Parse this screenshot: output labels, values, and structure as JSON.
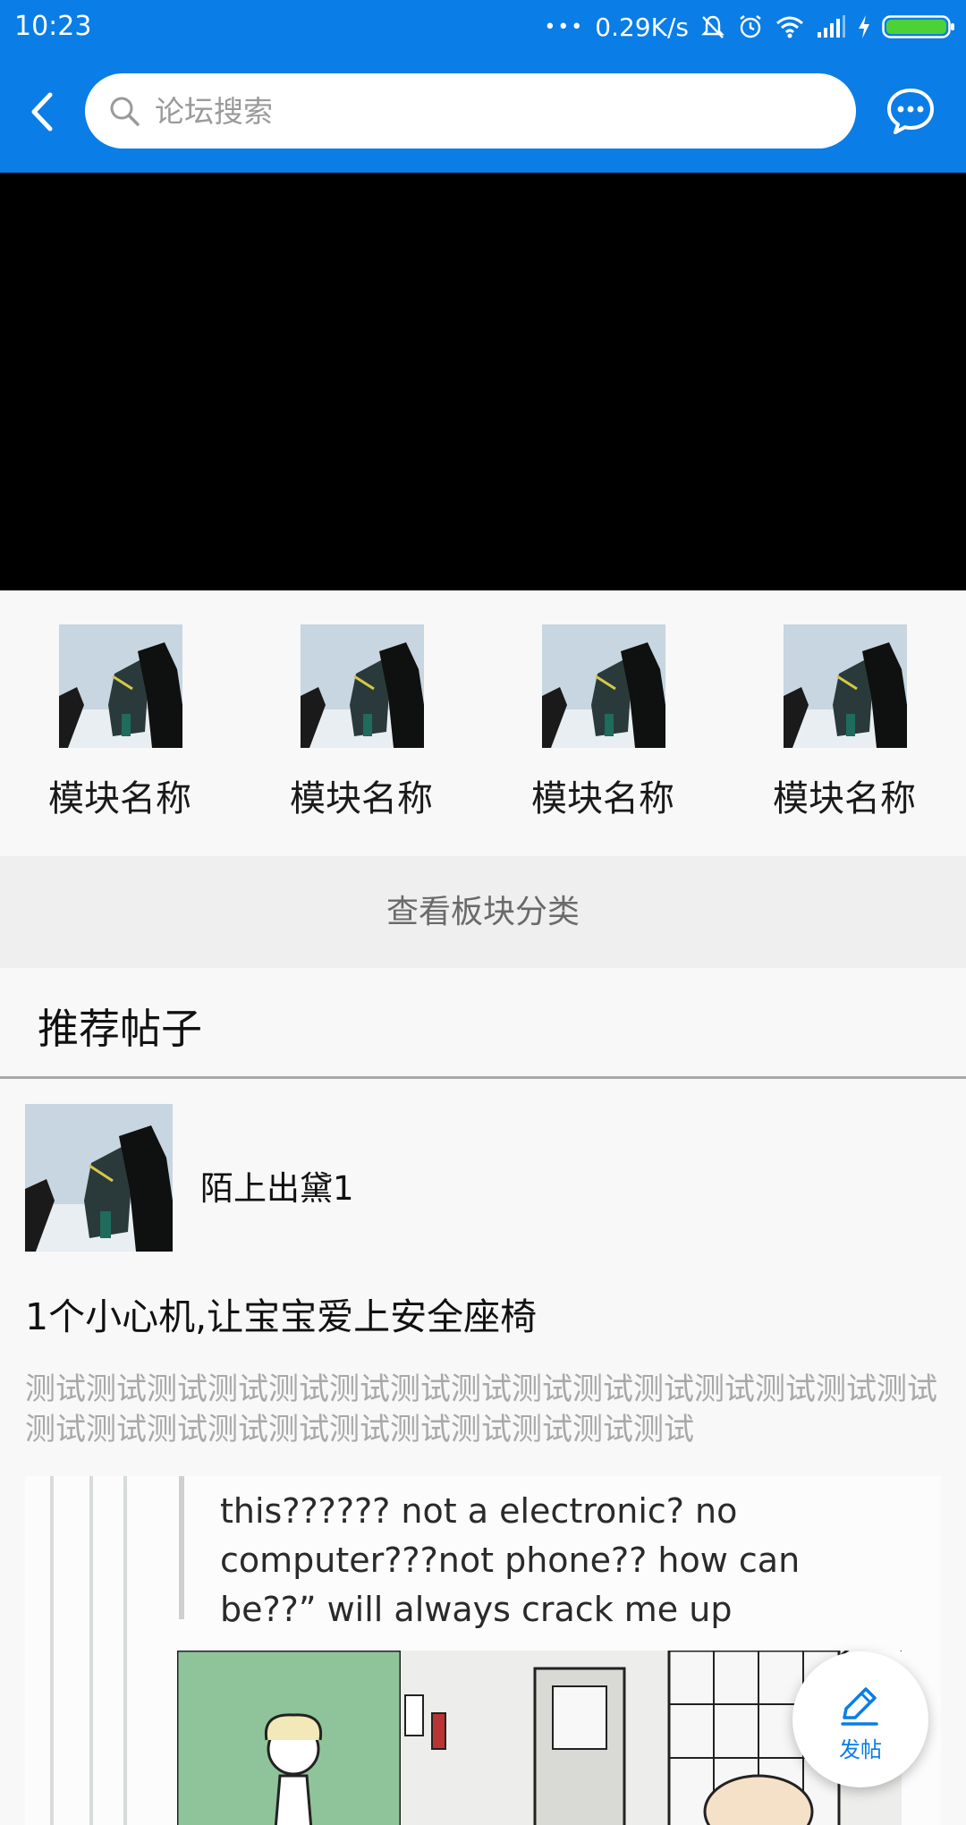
{
  "status_bar": {
    "time": "10:23",
    "dots": "•••",
    "network_speed": "0.29K/s",
    "icons": [
      "mute-icon",
      "alarm-icon",
      "wifi-icon",
      "signal-icon",
      "charging-icon",
      "battery-icon"
    ]
  },
  "header": {
    "search_placeholder": "论坛搜索",
    "accent_color": "#0a7de6"
  },
  "modules": [
    {
      "label": "模块名称"
    },
    {
      "label": "模块名称"
    },
    {
      "label": "模块名称"
    },
    {
      "label": "模块名称"
    }
  ],
  "view_categories_label": "查看板块分类",
  "section_title": "推荐帖子",
  "post": {
    "author": "陌上出黛1",
    "title": "1个小心机,让宝宝爱上安全座椅",
    "excerpt": "测试测试测试测试测试测试测试测试测试测试测试测试测试测试测试测试测试测试测试测试测试测试测试测试测试测试",
    "image_text_lines": [
      "this?????? not a electronic? no",
      "computer???not phone?? how can",
      "be??” will always crack me up"
    ]
  },
  "fab_label": "发帖"
}
